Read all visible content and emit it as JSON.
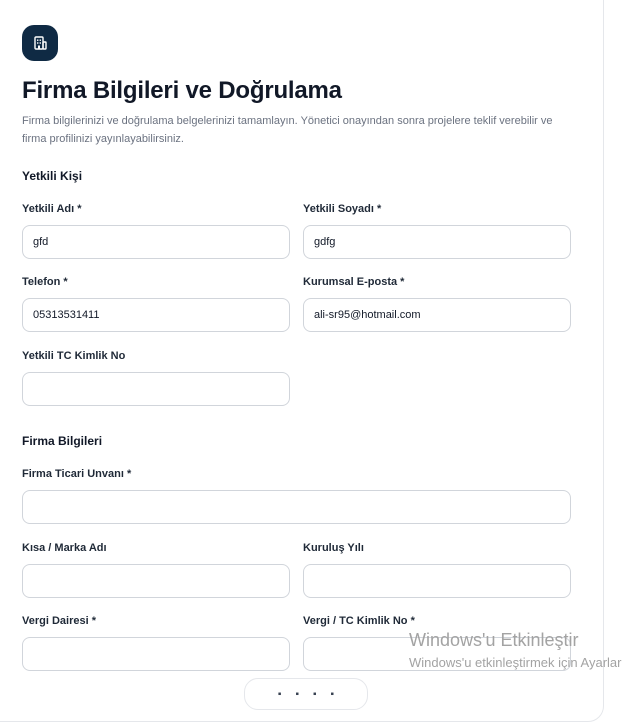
{
  "header": {
    "icon": "building-icon",
    "title": "Firma Bilgileri ve Doğrulama",
    "subtitle": "Firma bilgilerinizi ve doğrulama belgelerinizi tamamlayın. Yönetici onayından sonra projelere teklif verebilir ve firma profilinizi yayınlayabilirsiniz."
  },
  "authorized_person": {
    "section_title": "Yetkili Kişi",
    "first_name": {
      "label": "Yetkili Adı *",
      "value": "gfd"
    },
    "last_name": {
      "label": "Yetkili Soyadı *",
      "value": "gdfg"
    },
    "phone": {
      "label": "Telefon *",
      "value": "05313531411"
    },
    "email": {
      "label": "Kurumsal E-posta *",
      "value": "ali-sr95@hotmail.com"
    },
    "tc_no": {
      "label": "Yetkili TC Kimlik No",
      "value": ""
    }
  },
  "company": {
    "section_title": "Firma Bilgileri",
    "trade_name": {
      "label": "Firma Ticari Unvanı *",
      "value": ""
    },
    "brand_name": {
      "label": "Kısa / Marka Adı",
      "value": ""
    },
    "founded_year": {
      "label": "Kuruluş Yılı",
      "value": ""
    },
    "tax_office": {
      "label": "Vergi Dairesi *",
      "value": ""
    },
    "tax_no": {
      "label": "Vergi / TC Kimlik No *",
      "value": ""
    }
  },
  "watermark": {
    "line1": "Windows'u Etkinleştir",
    "line2": "Windows'u etkinleştirmek için Ayarlar"
  }
}
